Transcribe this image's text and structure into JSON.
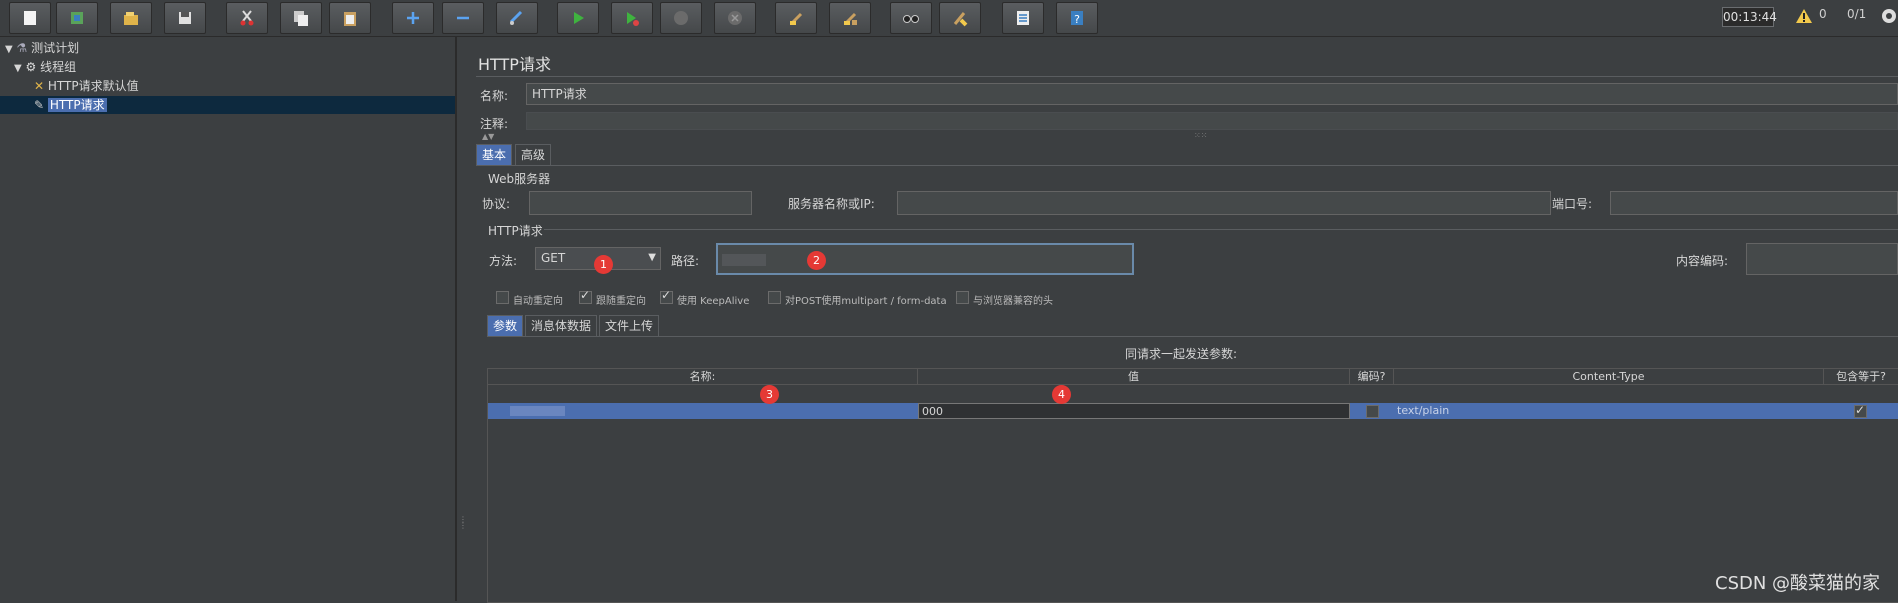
{
  "toolbar": {
    "timer": "00:13:44",
    "warning_count": "0",
    "thread_ratio": "0/1",
    "buttons": [
      "new-icon",
      "templates-icon",
      "open-icon",
      "save-icon",
      "cut-icon",
      "copy-icon",
      "paste-icon",
      "expand-icon",
      "collapse-icon",
      "toggle-icon",
      "start-icon",
      "start-no-pause-icon",
      "stop-icon",
      "shutdown-icon",
      "clear-icon",
      "clear-all-icon",
      "search-icon",
      "reset-search-icon",
      "function-helper-icon",
      "help-icon"
    ]
  },
  "tree": {
    "plan": "测试计划",
    "group": "线程组",
    "defaults": "HTTP请求默认值",
    "request": "HTTP请求"
  },
  "panel": {
    "title": "HTTP请求",
    "name_label": "名称:",
    "name_value": "HTTP请求",
    "comment_label": "注释:",
    "tabs": [
      "基本",
      "高级"
    ],
    "web_server_title": "Web服务器",
    "protocol_label": "协议:",
    "server_label": "服务器名称或IP:",
    "port_label": "端口号:",
    "http_request_title": "HTTP请求",
    "method_label": "方法:",
    "method_value": "GET",
    "path_label": "路径:",
    "encoding_label": "内容编码:",
    "checkboxes": [
      {
        "label": "自动重定向",
        "checked": false
      },
      {
        "label": "跟随重定向",
        "checked": true
      },
      {
        "label": "使用 KeepAlive",
        "checked": true
      },
      {
        "label": "对POST使用multipart / form-data",
        "checked": false
      },
      {
        "label": "与浏览器兼容的头",
        "checked": false
      }
    ],
    "sub_tabs": [
      "参数",
      "消息体数据",
      "文件上传"
    ],
    "params_title": "同请求一起发送参数:",
    "columns": [
      "名称:",
      "值",
      "编码?",
      "Content-Type",
      "包含等于?"
    ],
    "row": {
      "value": "000",
      "content_type": "text/plain",
      "include_equals": true
    }
  },
  "badges": [
    "1",
    "2",
    "3",
    "4"
  ],
  "watermark": "CSDN @酸菜猫的家",
  "colors": {
    "background": "#3c3f41",
    "selection": "#4b6eaf",
    "badge": "#e53935"
  }
}
